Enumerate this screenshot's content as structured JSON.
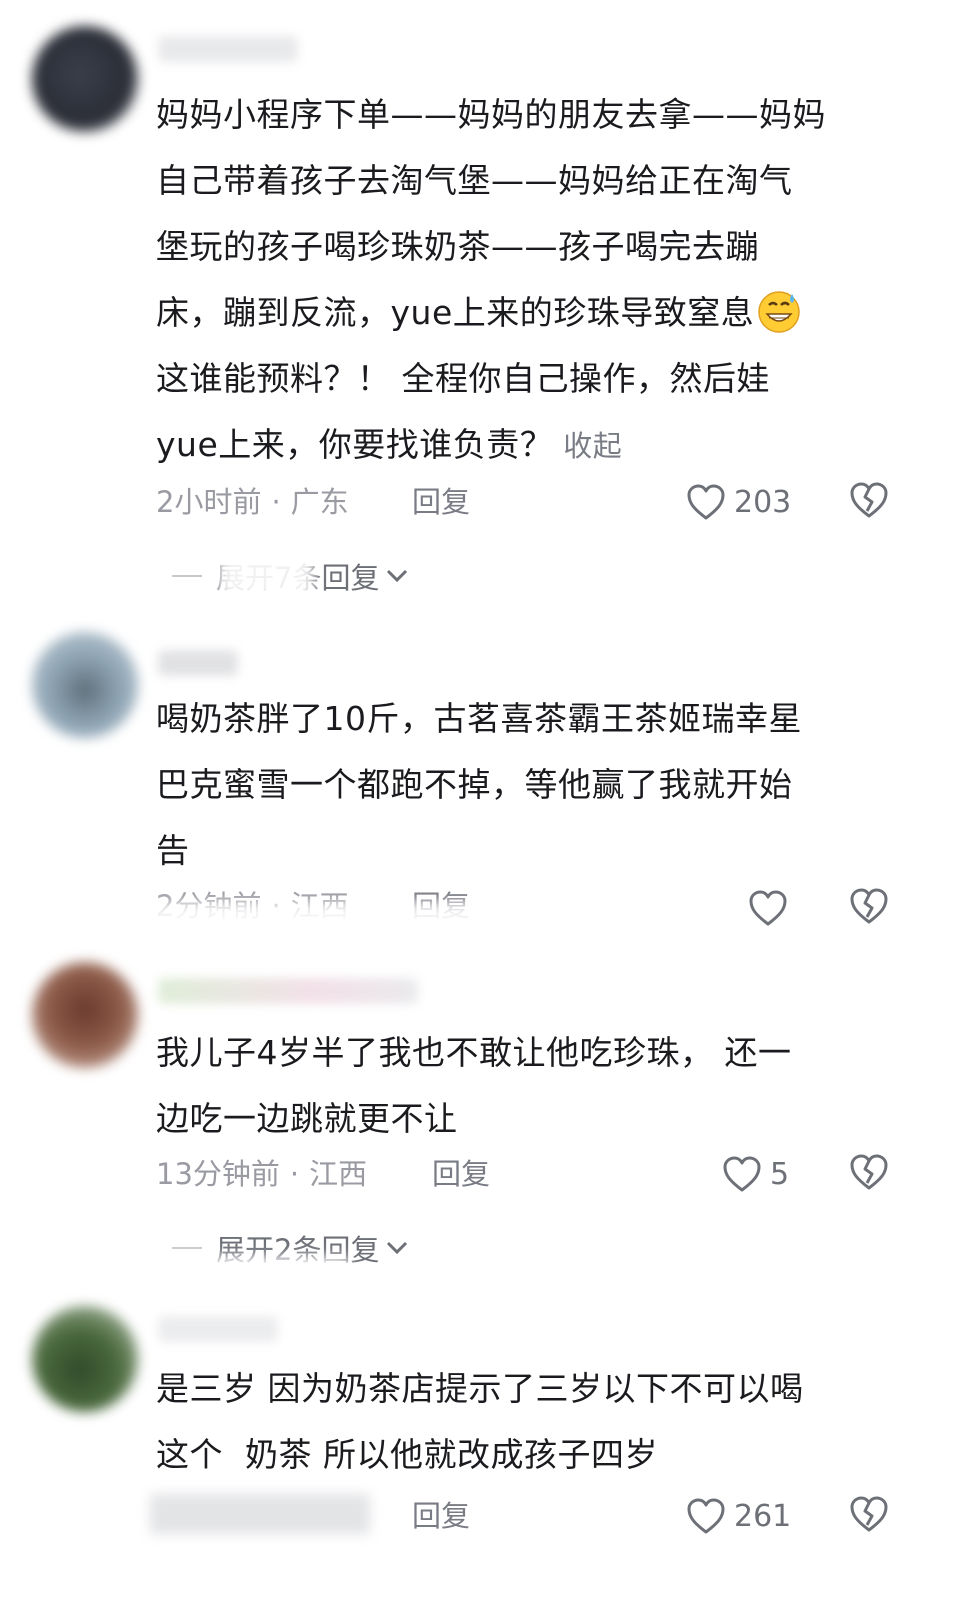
{
  "comments": [
    {
      "text_lines": [
        "妈妈小程序下单——妈妈的朋友去拿——妈妈",
        "自己带着孩子去淘气堡——妈妈给正在淘气",
        "堡玩的孩子喝珍珠奶茶——孩子喝完去蹦",
        "床，蹦到反流，yue上来的珍珠导致窒息",
        "这谁能预料？！ 全程你自己操作，然后娃",
        "yue上来，你要找谁负责？"
      ],
      "collapse_label": "收起",
      "time": "2小时前",
      "location": "广东",
      "reply_label": "回复",
      "likes": "203",
      "expand_label": "展开7条回复"
    },
    {
      "text_lines": [
        "喝奶茶胖了10斤，古茗喜茶霸王茶姬瑞幸星",
        "巴克蜜雪一个都跑不掉，等他赢了我就开始",
        "告"
      ],
      "time": "2分钟前",
      "location": "江西",
      "reply_label": "回复",
      "likes": ""
    },
    {
      "text_lines": [
        "我儿子4岁半了我也不敢让他吃珍珠， 还一",
        "边吃一边跳就更不让"
      ],
      "time": "13分钟前",
      "location": "江西",
      "reply_label": "回复",
      "likes": "5",
      "expand_label": "展开2条回复"
    },
    {
      "text_lines": [
        "是三岁 因为奶茶店提示了三岁以下不可以喝",
        "这个  奶茶 所以他就改成孩子四岁"
      ],
      "reply_label": "回复",
      "likes": "261"
    }
  ],
  "icons": {
    "like": "heart-outline-icon",
    "dislike": "broken-heart-icon",
    "expand": "chevron-down-icon",
    "emoji": "grinning-sweat-emoji"
  },
  "colors": {
    "text": "#1b1b1f",
    "meta": "#9a9ba2",
    "action": "#7a7c85"
  }
}
